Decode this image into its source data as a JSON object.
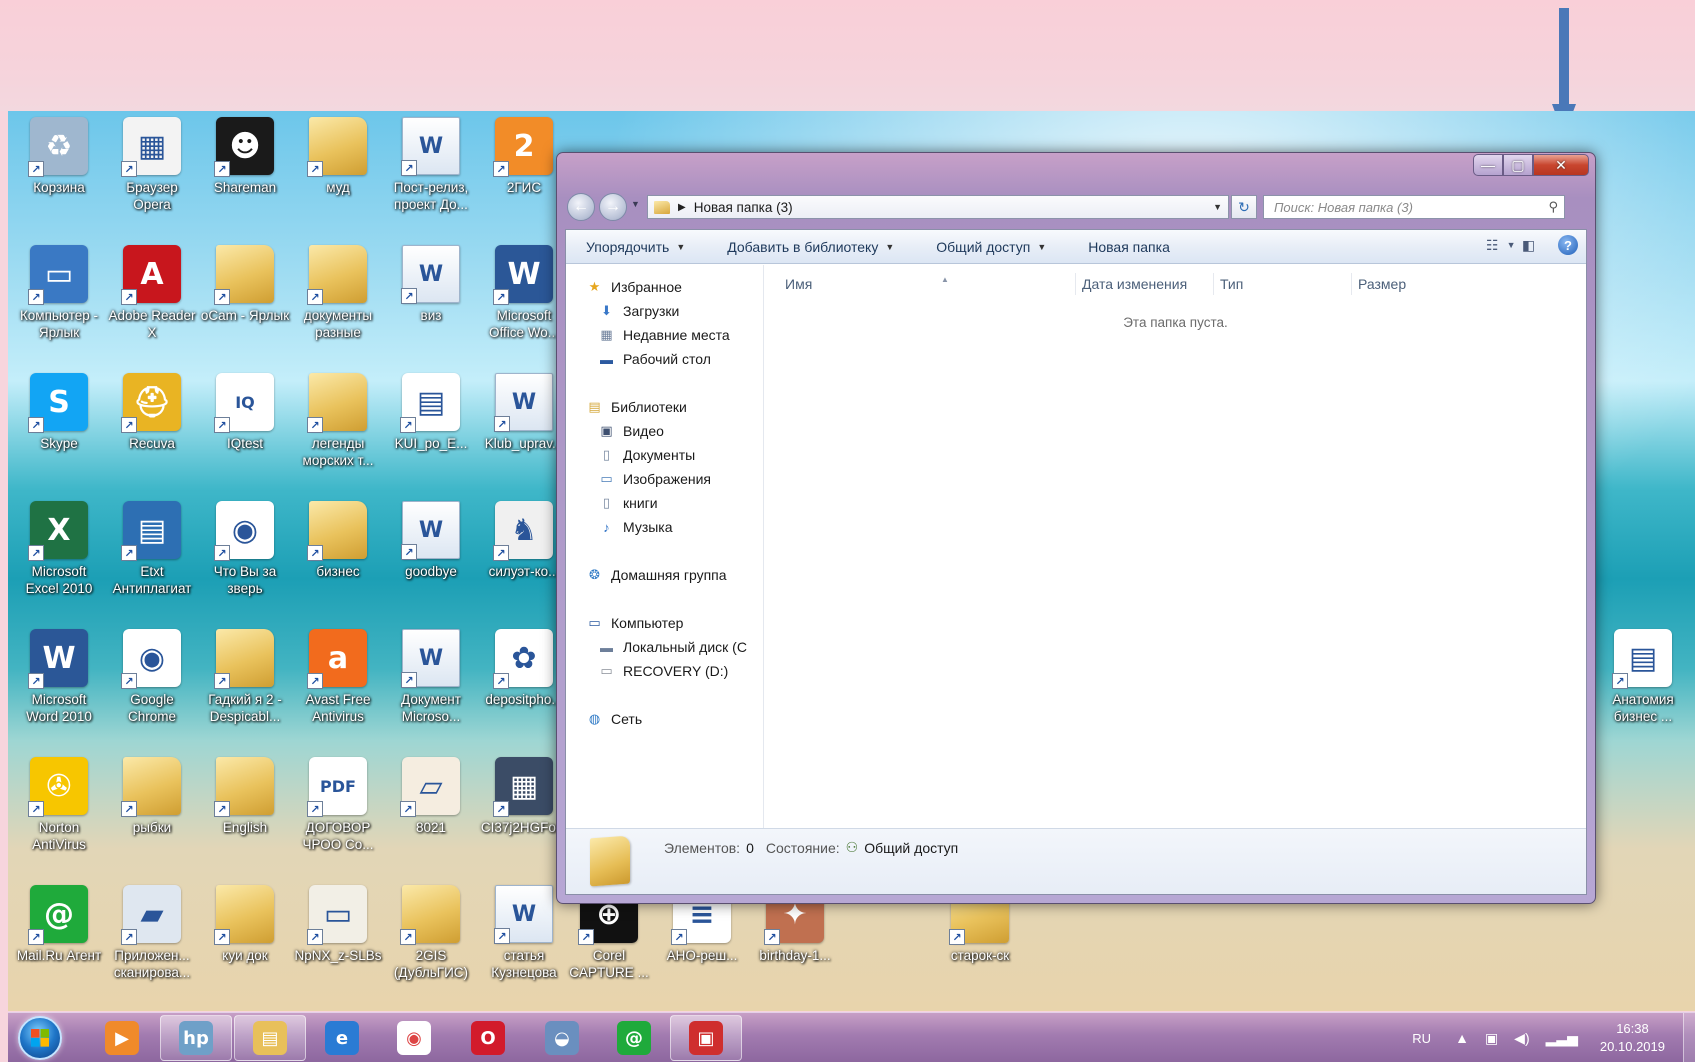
{
  "desktop_icons": [
    {
      "label": "Корзина",
      "icon": "recycle-bin-icon",
      "color": "#9fb7cf",
      "glyph": "♻"
    },
    {
      "label": "Браузер Opera",
      "icon": "opera-browser-icon",
      "color": "#f3f3f3",
      "glyph": "▦"
    },
    {
      "label": "Shareman",
      "icon": "shareman-icon",
      "color": "#1a1a1a",
      "glyph": "☻"
    },
    {
      "label": "муд",
      "icon": "folder-icon",
      "color": "",
      "glyph": ""
    },
    {
      "label": "Пост-релиз, проект До...",
      "icon": "word-document-icon",
      "color": "",
      "glyph": "W"
    },
    {
      "label": "2ГИС",
      "icon": "2gis-icon",
      "color": "#f28c28",
      "glyph": "2"
    },
    {
      "label": "Компьютер - Ярлык",
      "icon": "computer-icon",
      "color": "#3a79c4",
      "glyph": "▭"
    },
    {
      "label": "Adobe Reader X",
      "icon": "adobe-reader-icon",
      "color": "#c8161d",
      "glyph": "A"
    },
    {
      "label": "oCam - Ярлык",
      "icon": "folder-icon",
      "color": "",
      "glyph": ""
    },
    {
      "label": "документы разные",
      "icon": "folder-icon",
      "color": "",
      "glyph": ""
    },
    {
      "label": "виз",
      "icon": "word-document-icon",
      "color": "",
      "glyph": "W"
    },
    {
      "label": "Microsoft Office Wo...",
      "icon": "word-icon",
      "color": "#2b5797",
      "glyph": "W"
    },
    {
      "label": "Skype",
      "icon": "skype-icon",
      "color": "#12a5f4",
      "glyph": "S"
    },
    {
      "label": "Recuva",
      "icon": "recuva-icon",
      "color": "#e9b423",
      "glyph": "⛑"
    },
    {
      "label": "IQtest",
      "icon": "iqtest-icon",
      "color": "#ffffff",
      "glyph": "IQ"
    },
    {
      "label": "легенды морских т...",
      "icon": "folder-icon",
      "color": "",
      "glyph": ""
    },
    {
      "label": "KUI_po_E...",
      "icon": "image-document-icon",
      "color": "#ffffff",
      "glyph": "▤"
    },
    {
      "label": "Klub_uprav...",
      "icon": "word-document-icon",
      "color": "",
      "glyph": "W"
    },
    {
      "label": "Microsoft Excel 2010",
      "icon": "excel-icon",
      "color": "#1f7244",
      "glyph": "X"
    },
    {
      "label": "Etxt Антиплагиат",
      "icon": "etxt-icon",
      "color": "#2d6fb3",
      "glyph": "▤"
    },
    {
      "label": "Что Вы за зверь",
      "icon": "chrome-icon",
      "color": "#ffffff",
      "glyph": "◉"
    },
    {
      "label": "бизнес",
      "icon": "folder-icon",
      "color": "",
      "glyph": ""
    },
    {
      "label": "goodbye",
      "icon": "word-document-icon",
      "color": "",
      "glyph": "W"
    },
    {
      "label": "силуэт-ко...",
      "icon": "image-icon",
      "color": "#f0f0f0",
      "glyph": "♞"
    },
    {
      "label": "Microsoft Word 2010",
      "icon": "word-icon",
      "color": "#2b5797",
      "glyph": "W"
    },
    {
      "label": "Google Chrome",
      "icon": "chrome-icon",
      "color": "#ffffff",
      "glyph": "◉"
    },
    {
      "label": "Гадкий я 2 - Despicabl...",
      "icon": "folder-icon",
      "color": "",
      "glyph": ""
    },
    {
      "label": "Avast Free Antivirus",
      "icon": "avast-icon",
      "color": "#f26b1d",
      "glyph": "a"
    },
    {
      "label": "Документ Microso...",
      "icon": "word-document-icon",
      "color": "",
      "glyph": "W"
    },
    {
      "label": "depositpho...",
      "icon": "image-icon",
      "color": "#ffffff",
      "glyph": "✿"
    },
    {
      "label": "Norton AntiVirus",
      "icon": "norton-icon",
      "color": "#f7c600",
      "glyph": "✇"
    },
    {
      "label": "рыбки",
      "icon": "folder-icon",
      "color": "",
      "glyph": ""
    },
    {
      "label": "English",
      "icon": "folder-icon",
      "color": "",
      "glyph": ""
    },
    {
      "label": "ДОГОВОР ЧРОО Со...",
      "icon": "pdf-document-icon",
      "color": "#ffffff",
      "glyph": "PDF"
    },
    {
      "label": "8021",
      "icon": "image-icon",
      "color": "#f5ede0",
      "glyph": "▱"
    },
    {
      "label": "CI37j2HGFo...",
      "icon": "image-icon",
      "color": "#3b4c66",
      "glyph": "▦"
    },
    {
      "label": "Mail.Ru Агент",
      "icon": "mailru-agent-icon",
      "color": "#1faa3b",
      "glyph": "@"
    },
    {
      "label": "Приложен... сканирова...",
      "icon": "scanner-icon",
      "color": "#dfe7f0",
      "glyph": "▰"
    },
    {
      "label": "куи док",
      "icon": "folder-icon",
      "color": "",
      "glyph": ""
    },
    {
      "label": "NpNX_z-SLBs",
      "icon": "image-icon",
      "color": "#f2efe6",
      "glyph": "▭"
    },
    {
      "label": "2GIS (ДубльГИС)",
      "icon": "folder-icon",
      "color": "",
      "glyph": ""
    },
    {
      "label": "статья Кузнецова",
      "icon": "word-document-icon",
      "color": "",
      "glyph": "W"
    },
    {
      "label": "Corel CAPTURE ...",
      "icon": "corel-capture-icon",
      "color": "#111111",
      "glyph": "⊕"
    },
    {
      "label": "АНО-реш...",
      "icon": "text-document-icon",
      "color": "#ffffff",
      "glyph": "≡"
    },
    {
      "label": "birthday-1...",
      "icon": "image-icon",
      "color": "#c07050",
      "glyph": "✦"
    },
    {
      "label": "старок-ск",
      "icon": "folder-icon",
      "color": "",
      "glyph": ""
    },
    {
      "label": "Анатомия бизнес ...",
      "icon": "image-document-icon",
      "color": "#ffffff",
      "glyph": "▤"
    }
  ],
  "window": {
    "address": "Новая папка (3)",
    "search_placeholder": "Поиск: Новая папка (3)",
    "minimize_glyph": "—",
    "maximize_glyph": "▢",
    "close_glyph": "✕",
    "back_glyph": "←",
    "forward_glyph": "→",
    "refresh_glyph": "↻",
    "search_glyph": "⚲"
  },
  "toolbar": {
    "organize": "Упорядочить",
    "add_to_library": "Добавить в библиотеку",
    "share": "Общий доступ",
    "new_folder": "Новая папка",
    "help": "?"
  },
  "nav": {
    "favorites": "Избранное",
    "downloads": "Загрузки",
    "recent": "Недавние места",
    "desktop": "Рабочий стол",
    "libraries": "Библиотеки",
    "video": "Видео",
    "documents": "Документы",
    "images": "Изображения",
    "books": "книги",
    "music": "Музыка",
    "homegroup": "Домашняя группа",
    "computer": "Компьютер",
    "local_disk": "Локальный диск (C",
    "recovery": "RECOVERY (D:)",
    "network": "Сеть"
  },
  "columns": {
    "name": "Имя",
    "date": "Дата изменения",
    "type": "Тип",
    "size": "Размер"
  },
  "empty_message": "Эта папка пуста.",
  "details": {
    "items_label": "Элементов:",
    "items_value": "0",
    "state_label": "Состояние:",
    "state_value": "Общий доступ"
  },
  "taskbar": {
    "apps": [
      {
        "name": "media-player",
        "color": "#f08a2a",
        "glyph": "▶"
      },
      {
        "name": "hp-app",
        "color": "#6fa0c8",
        "glyph": "hp"
      },
      {
        "name": "windows-explorer",
        "color": "#e8c05a",
        "glyph": "▤"
      },
      {
        "name": "internet-explorer",
        "color": "#2a7bd4",
        "glyph": "e"
      },
      {
        "name": "google-chrome",
        "color": "#ffffff",
        "glyph": "◉"
      },
      {
        "name": "opera",
        "color": "#d21b2b",
        "glyph": "O"
      },
      {
        "name": "flash-app",
        "color": "#6a8fbf",
        "glyph": "◒"
      },
      {
        "name": "mailru-agent",
        "color": "#1faa3b",
        "glyph": "@"
      },
      {
        "name": "pdf-app",
        "color": "#cf2e2e",
        "glyph": "▣"
      }
    ],
    "lang": "RU",
    "time": "16:38",
    "date": "20.10.2019"
  }
}
